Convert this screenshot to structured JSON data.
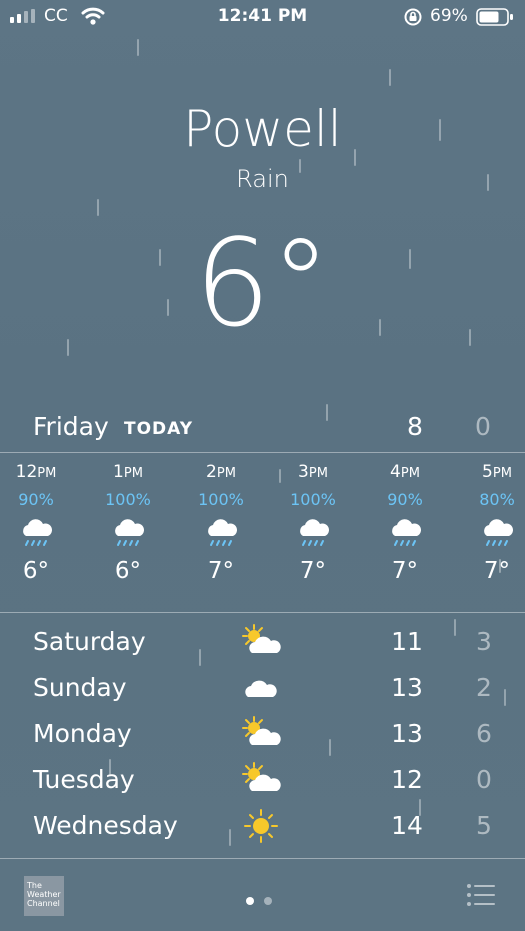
{
  "status": {
    "carrier": "CC",
    "time": "12:41 PM",
    "battery_pct": "69%"
  },
  "location": {
    "city": "Powell",
    "condition": "Rain",
    "temp": "6°"
  },
  "today": {
    "day": "Friday",
    "tag": "TODAY",
    "high": "8",
    "low": "0"
  },
  "hourly": [
    {
      "time": "12",
      "ampm": "PM",
      "precip": "90%",
      "icon": "rain-cloud-icon",
      "temp": "6°"
    },
    {
      "time": "1",
      "ampm": "PM",
      "precip": "100%",
      "icon": "rain-cloud-icon",
      "temp": "6°"
    },
    {
      "time": "2",
      "ampm": "PM",
      "precip": "100%",
      "icon": "rain-cloud-icon",
      "temp": "7°"
    },
    {
      "time": "3",
      "ampm": "PM",
      "precip": "100%",
      "icon": "rain-cloud-icon",
      "temp": "7°"
    },
    {
      "time": "4",
      "ampm": "PM",
      "precip": "90%",
      "icon": "rain-cloud-icon",
      "temp": "7°"
    },
    {
      "time": "5",
      "ampm": "PM",
      "precip": "80%",
      "icon": "rain-cloud-icon",
      "temp": "7°"
    }
  ],
  "daily": [
    {
      "day": "Saturday",
      "icon": "partly-sunny-icon",
      "high": "11",
      "low": "3"
    },
    {
      "day": "Sunday",
      "icon": "cloud-icon",
      "high": "13",
      "low": "2"
    },
    {
      "day": "Monday",
      "icon": "partly-sunny-icon",
      "high": "13",
      "low": "6"
    },
    {
      "day": "Tuesday",
      "icon": "partly-sunny-icon",
      "high": "12",
      "low": "0"
    },
    {
      "day": "Wednesday",
      "icon": "sun-icon",
      "high": "14",
      "low": "5"
    }
  ],
  "footer": {
    "logo_text": "The Weather Channel",
    "page_count": 2,
    "active_page": 1
  },
  "colors": {
    "precip": "#6cc4f5",
    "sun": "#f7c82b",
    "background": "#5d7585"
  }
}
